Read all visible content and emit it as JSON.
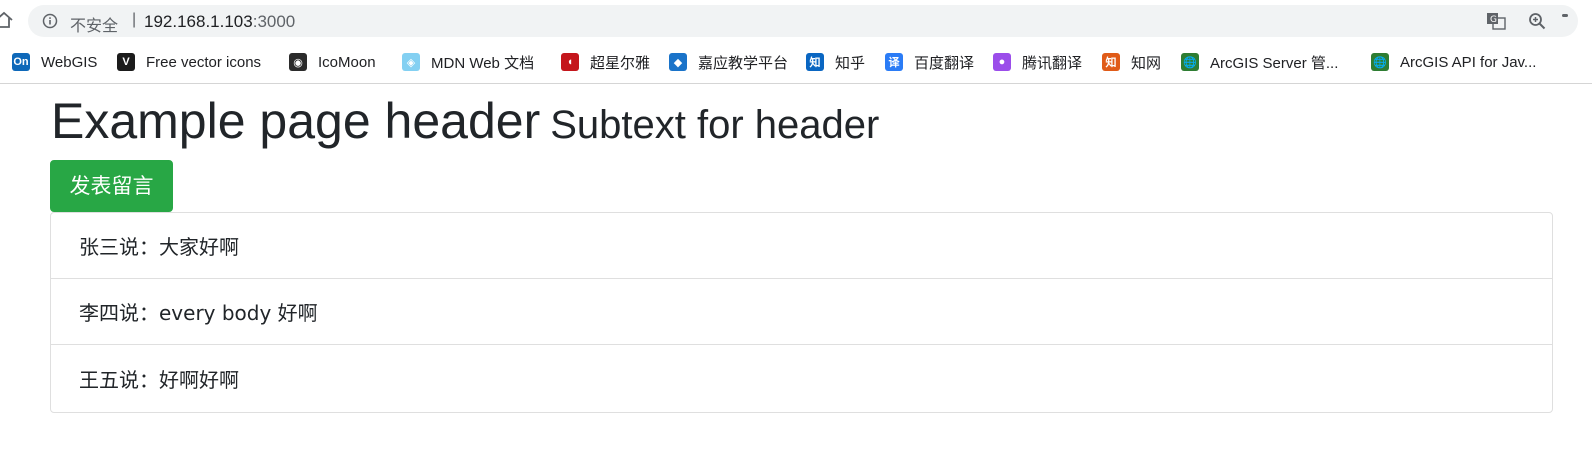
{
  "browser": {
    "insecure_label": "不安全",
    "separator": "|",
    "url_host": "192.168.1.103",
    "url_port": ":3000",
    "bookmarks": [
      {
        "label": "WebGIS",
        "icon": "onenote-icon",
        "icon_text": "On",
        "color": "#0e68b9"
      },
      {
        "label": "Free vector icons",
        "icon": "vector-icon",
        "icon_text": "V",
        "color": "#1b1b1b"
      },
      {
        "label": "IcoMoon",
        "icon": "icomoon-icon",
        "icon_text": "◉",
        "color": "#2b2b2b"
      },
      {
        "label": "MDN Web 文档",
        "icon": "mdn-icon",
        "icon_text": "◈",
        "color": "#83d0f2"
      },
      {
        "label": "超星尔雅",
        "icon": "chaoxing-icon",
        "icon_text": "◖",
        "color": "#c4161c"
      },
      {
        "label": "嘉应教学平台",
        "icon": "jiaying-icon",
        "icon_text": "◆",
        "color": "#1a73c9"
      },
      {
        "label": "知乎",
        "icon": "zhihu-icon",
        "icon_text": "知",
        "color": "#0a66c2"
      },
      {
        "label": "百度翻译",
        "icon": "baidu-translate-icon",
        "icon_text": "译",
        "color": "#2b7cf6"
      },
      {
        "label": "腾讯翻译",
        "icon": "tencent-translate-icon",
        "icon_text": "●",
        "color": "#9b4dea"
      },
      {
        "label": "知网",
        "icon": "cnki-icon",
        "icon_text": "知",
        "color": "#e05b18"
      },
      {
        "label": "ArcGIS Server 管...",
        "icon": "globe-icon",
        "icon_text": "🌐",
        "color": "#2e7d32"
      },
      {
        "label": "ArcGIS API for Jav...",
        "icon": "globe-icon",
        "icon_text": "🌐",
        "color": "#2e7d32"
      }
    ]
  },
  "header": {
    "title": "Example page header",
    "subtitle": "Subtext for header"
  },
  "post_button_label": "发表留言",
  "messages": [
    {
      "author": "张三",
      "say": "说：",
      "text": "大家好啊"
    },
    {
      "author": "李四",
      "say": "说：",
      "text": "every body 好啊"
    },
    {
      "author": "王五",
      "say": "说：",
      "text": "好啊好啊"
    }
  ],
  "colors": {
    "button_bg": "#28a745",
    "border": "#dfdfdf"
  }
}
